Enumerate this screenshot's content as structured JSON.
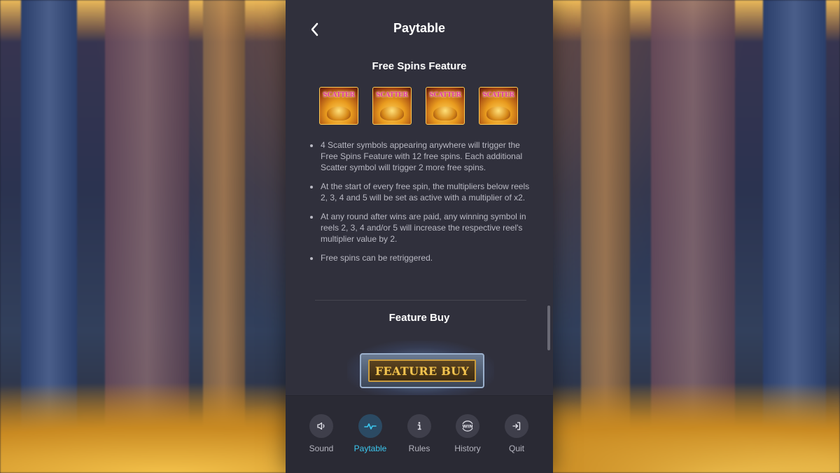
{
  "header": {
    "title": "Paytable"
  },
  "free_spins": {
    "title": "Free Spins Feature",
    "symbol_label": "SCATTER",
    "symbol_count": 4,
    "bullets": [
      "4 Scatter symbols appearing anywhere will trigger the Free Spins Feature with 12 free spins. Each additional Scatter symbol will trigger 2 more free spins.",
      "At the start of every free spin, the multipliers below reels 2, 3, 4 and 5 will be set as active with a multiplier of x2.",
      "At any round after wins are paid, any winning symbol in reels 2, 3, 4 and/or 5 will increase the respective reel's multiplier value by 2.",
      "Free spins can be retriggered."
    ]
  },
  "feature_buy": {
    "title": "Feature Buy",
    "button_label": "FEATURE BUY"
  },
  "nav": {
    "items": [
      {
        "label": "Sound",
        "icon": "speaker-icon"
      },
      {
        "label": "Paytable",
        "icon": "pulse-icon"
      },
      {
        "label": "Rules",
        "icon": "info-icon"
      },
      {
        "label": "History",
        "icon": "win-icon",
        "icon_text": "WIN"
      },
      {
        "label": "Quit",
        "icon": "exit-icon"
      }
    ],
    "active": "Paytable"
  },
  "colors": {
    "accent": "#3cc8f0",
    "panel": "#30303c",
    "text_muted": "#b9b9c3"
  }
}
